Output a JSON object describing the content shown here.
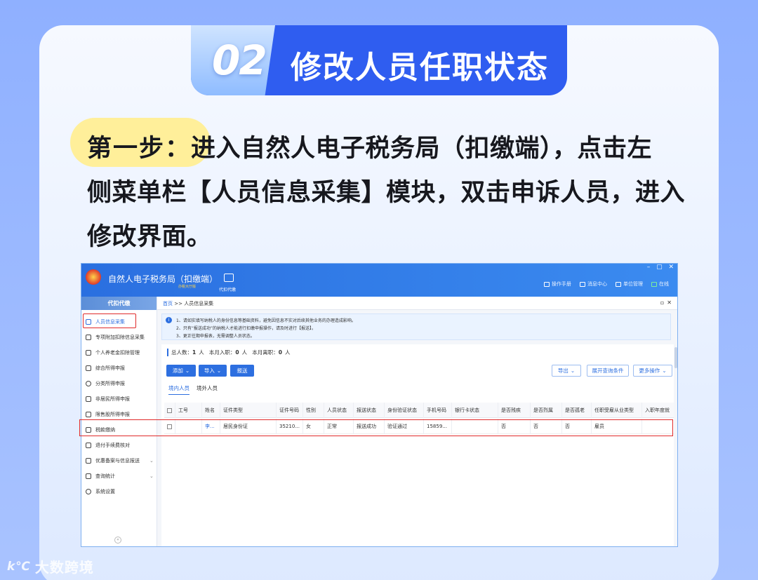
{
  "banner": {
    "number": "02",
    "title": "修改人员任职状态"
  },
  "step": {
    "label": "第一步：",
    "line1": "进入自然人电子税务局（扣缴端），点击左",
    "line2": "侧菜单栏【人员信息采集】模块，双击申诉人员，进入",
    "line3": "修改界面。"
  },
  "app": {
    "title": "自然人电子税务局（扣缴端）",
    "subtitle": "办税大厅版",
    "proxy_label": "代扣代缴",
    "header_links": [
      "操作手册",
      "消息中心",
      "单位管理",
      "在线"
    ],
    "sidebar_title": "代扣代缴",
    "sidebar_items": [
      {
        "label": "人员信息采集",
        "active": true
      },
      {
        "label": "专项附加扣除信息采集",
        "active": false
      },
      {
        "label": "个人养老金扣除管理",
        "active": false
      },
      {
        "label": "综合所得申报",
        "active": false
      },
      {
        "label": "分类所得申报",
        "active": false
      },
      {
        "label": "非居民所得申报",
        "active": false
      },
      {
        "label": "限售股所得申报",
        "active": false
      },
      {
        "label": "税款缴纳",
        "active": false
      },
      {
        "label": "退付手续费核对",
        "active": false
      },
      {
        "label": "优惠备案与信息报送",
        "active": false
      },
      {
        "label": "查询统计",
        "active": false
      },
      {
        "label": "系统设置",
        "active": false
      }
    ],
    "breadcrumb_home": "首页",
    "breadcrumb_sep": ">>",
    "breadcrumb_page": "人员信息采集",
    "notice": [
      "1、请如实填写纳税人的身份信息等基础资料，避免因信息不实对后续其他业务的办理造成影响。",
      "2、只有“报送成功”的纳税人才能进行扣缴申报操作，请及时进行【报送】。",
      "3、更正往期申报表，无需调整人员状态。"
    ],
    "stats": {
      "total_label": "总人数：",
      "total": "1",
      "total_unit": "人",
      "month_in_label": "本月入职：",
      "month_in": "0",
      "month_in_unit": "人",
      "month_out_label": "本月离职：",
      "month_out": "0",
      "month_out_unit": "人"
    },
    "buttons": {
      "add": "添加",
      "import": "导入",
      "submit": "报送",
      "export": "导出",
      "query": "展开查询条件",
      "more": "更多操作"
    },
    "tabs": [
      "境内人员",
      "境外人员"
    ],
    "columns": [
      "",
      "工号",
      "姓名",
      "证件类型",
      "证件号码",
      "性别",
      "人员状态",
      "报送状态",
      "身份验证状态",
      "手机号码",
      "银行卡状态",
      "是否残疾",
      "是否烈属",
      "是否孤老",
      "任职受雇从业类型",
      "入职年度就"
    ],
    "rows": [
      [
        "",
        "",
        "李...",
        "居民身份证",
        "35210...",
        "女",
        "正常",
        "报送成功",
        "验证通过",
        "15859...",
        "",
        "否",
        "否",
        "否",
        "雇员",
        ""
      ]
    ]
  },
  "watermark": {
    "logo": "k℃",
    "text": "大数跨境"
  }
}
